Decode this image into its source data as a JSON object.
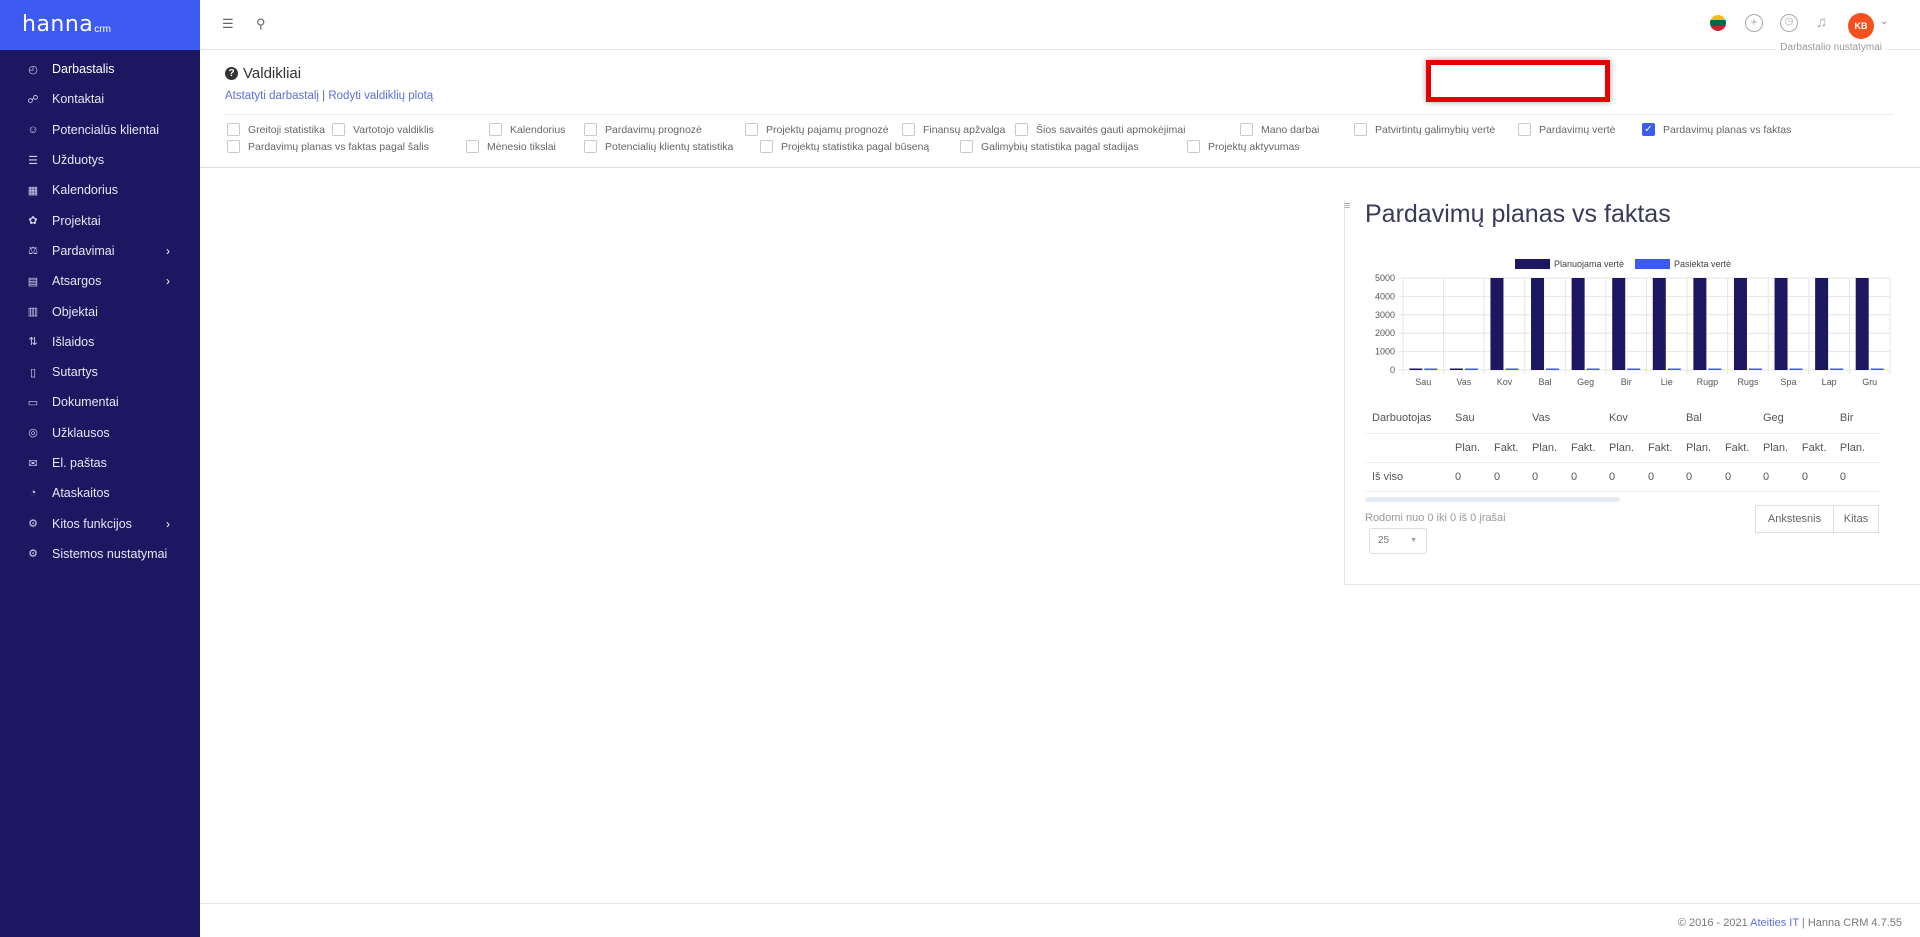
{
  "brand": {
    "name": "hanna",
    "suffix": "crm"
  },
  "sidebar": {
    "items": [
      {
        "label": "Darbastalis",
        "icon": "dashboard-icon",
        "glyph": "◴",
        "chevron": false,
        "active": true
      },
      {
        "label": "Kontaktai",
        "icon": "contacts-icon",
        "glyph": "☍",
        "chevron": false
      },
      {
        "label": "Potencialūs klientai",
        "icon": "leads-icon",
        "glyph": "☺",
        "chevron": false
      },
      {
        "label": "Užduotys",
        "icon": "tasks-icon",
        "glyph": "☰",
        "chevron": false
      },
      {
        "label": "Kalendorius",
        "icon": "calendar-icon",
        "glyph": "▦",
        "chevron": false
      },
      {
        "label": "Projektai",
        "icon": "projects-icon",
        "glyph": "✿",
        "chevron": false
      },
      {
        "label": "Pardavimai",
        "icon": "sales-icon",
        "glyph": "⚖",
        "chevron": true
      },
      {
        "label": "Atsargos",
        "icon": "stock-icon",
        "glyph": "▤",
        "chevron": true
      },
      {
        "label": "Objektai",
        "icon": "objects-icon",
        "glyph": "▥",
        "chevron": false
      },
      {
        "label": "Išlaidos",
        "icon": "expenses-icon",
        "glyph": "⇅",
        "chevron": false
      },
      {
        "label": "Sutartys",
        "icon": "contracts-icon",
        "glyph": "▯",
        "chevron": false
      },
      {
        "label": "Dokumentai",
        "icon": "documents-icon",
        "glyph": "▭",
        "chevron": false
      },
      {
        "label": "Užklausos",
        "icon": "inquiries-icon",
        "glyph": "◎",
        "chevron": false
      },
      {
        "label": "El. paštas",
        "icon": "email-icon",
        "glyph": "✉",
        "chevron": false
      },
      {
        "label": "Ataskaitos",
        "icon": "reports-icon",
        "glyph": "◔",
        "chevron": false
      },
      {
        "label": "Kitos funkcijos",
        "icon": "other-functions-icon",
        "glyph": "⚙",
        "chevron": true
      },
      {
        "label": "Sistemos nustatymai",
        "icon": "system-settings-icon",
        "glyph": "⚙",
        "chevron": false
      }
    ]
  },
  "topbar": {
    "avatar_initials": "KB",
    "settings_label": "Darbastalio nustatymai",
    "flag_colors": [
      "#fdb913",
      "#006a44",
      "#c1272d"
    ]
  },
  "widgets": {
    "title": "Valdikliai",
    "link_reset": "Atstatyti darbastalį",
    "link_separator": " | ",
    "link_show_area": "Rodyti valdiklių plotą",
    "row1": [
      {
        "label": "Greitoji statistika",
        "checked": false
      },
      {
        "label": "Vartotojo valdiklis",
        "checked": false
      },
      {
        "label": "Kalendorius",
        "checked": false
      },
      {
        "label": "Pardavimų prognozė",
        "checked": false
      },
      {
        "label": "Projektų pajamų prognozė",
        "checked": false
      },
      {
        "label": "Finansų apžvalga",
        "checked": false
      },
      {
        "label": "Šios savaitės gauti apmokėjimai",
        "checked": false
      },
      {
        "label": "Mano darbai",
        "checked": false
      },
      {
        "label": "Patvirtintų galimybių vertė",
        "checked": false
      },
      {
        "label": "Pardavimų vertė",
        "checked": false
      },
      {
        "label": "Pardavimų planas vs faktas",
        "checked": true
      }
    ],
    "row2": [
      {
        "label": "Pardavimų planas vs faktas pagal šalis",
        "checked": false
      },
      {
        "label": "Mėnesio tikslai",
        "checked": false
      },
      {
        "label": "Potencialių klientų statistika",
        "checked": false
      },
      {
        "label": "Projektų statistika pagal būseną",
        "checked": false
      },
      {
        "label": "Galimybių statistika pagal stadijas",
        "checked": false
      },
      {
        "label": "Projektų aktyvumas",
        "checked": false
      }
    ]
  },
  "chart_widget": {
    "title": "Pardavimų planas vs faktas"
  },
  "chart_data": {
    "type": "bar",
    "categories": [
      "Sau",
      "Vas",
      "Kov",
      "Bal",
      "Geg",
      "Bir",
      "Lie",
      "Rugp",
      "Rugs",
      "Spa",
      "Lap",
      "Gru"
    ],
    "series": [
      {
        "name": "Planuojama vertė",
        "color": "#1c1760",
        "values": [
          0,
          0,
          5000,
          5000,
          5000,
          5000,
          5000,
          5000,
          5000,
          5000,
          5000,
          5000
        ]
      },
      {
        "name": "Pasiekta vertė",
        "color": "#3d5af1",
        "values": [
          0,
          0,
          0,
          0,
          0,
          0,
          0,
          0,
          0,
          0,
          0,
          0
        ]
      }
    ],
    "yticks": [
      5000,
      4000,
      3000,
      2000,
      1000,
      0
    ],
    "ylim": [
      0,
      5000
    ],
    "grid": true,
    "legend_position": "top"
  },
  "table": {
    "header_first": "Darbuotojas",
    "months": [
      "Sau",
      "Vas",
      "Kov",
      "Bal",
      "Geg",
      "Bir"
    ],
    "sub_headers": [
      "Plan.",
      "Fakt.",
      "Plan.",
      "Fakt.",
      "Plan.",
      "Fakt.",
      "Plan.",
      "Fakt.",
      "Plan.",
      "Fakt.",
      "Plan."
    ],
    "total_label": "Iš viso",
    "total_values": [
      "0",
      "0",
      "0",
      "0",
      "0",
      "0",
      "0",
      "0",
      "0",
      "0",
      "0"
    ]
  },
  "pagination": {
    "info": "Rodomi nuo 0 iki 0 iš 0 įrašai",
    "page_size": "25",
    "prev": "Ankstesnis",
    "next": "Kitas"
  },
  "footer": {
    "prefix": "© 2016 - 2021 ",
    "company": "Ateities IT",
    "suffix": " | Hanna CRM 4.7.55"
  }
}
